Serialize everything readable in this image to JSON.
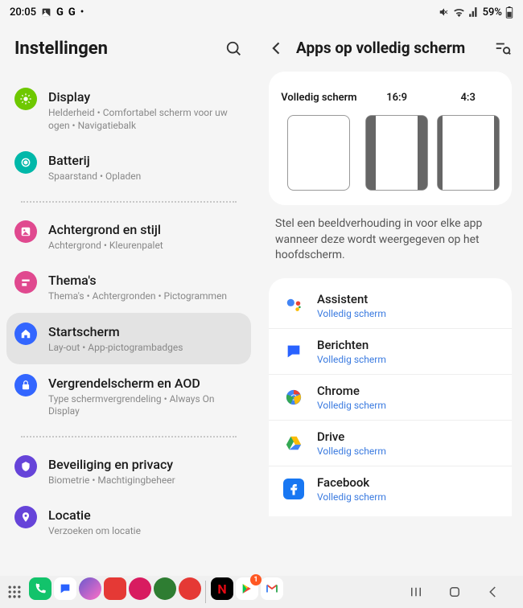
{
  "status": {
    "time": "20:05",
    "battery": "59%"
  },
  "left": {
    "title": "Instellingen",
    "items": [
      {
        "title": "Display",
        "sub": "Helderheid  •  Comfortabel scherm voor uw ogen  •  Navigatiebalk",
        "iconBg": "#6ec800"
      },
      {
        "title": "Batterij",
        "sub": "Spaarstand  •  Opladen",
        "iconBg": "#00b8a9"
      },
      {
        "title": "Achtergrond en stijl",
        "sub": "Achtergrond  •  Kleurenpalet",
        "iconBg": "#e0498f"
      },
      {
        "title": "Thema's",
        "sub": "Thema's  •  Achtergronden  •  Pictogrammen",
        "iconBg": "#e0498f"
      },
      {
        "title": "Startscherm",
        "sub": "Lay-out  •  App-pictogrambadges",
        "iconBg": "#3366ff"
      },
      {
        "title": "Vergrendelscherm en AOD",
        "sub": "Type schermvergrendeling  •  Always On Display",
        "iconBg": "#3366ff"
      },
      {
        "title": "Beveiliging en privacy",
        "sub": "Biometrie  •  Machtigingbeheer",
        "iconBg": "#6644d9"
      },
      {
        "title": "Locatie",
        "sub": "Verzoeken om locatie",
        "iconBg": "#6644d9"
      }
    ]
  },
  "right": {
    "title": "Apps op volledig scherm",
    "aspects": [
      {
        "label": "Volledig scherm",
        "cls": "full"
      },
      {
        "label": "16:9",
        "cls": "r169"
      },
      {
        "label": "4:3",
        "cls": "r43"
      }
    ],
    "description": "Stel een beeldverhouding in voor elke app wanneer deze wordt weergegeven op het hoofdscherm.",
    "apps": [
      {
        "name": "Assistent",
        "setting": "Volledig scherm"
      },
      {
        "name": "Berichten",
        "setting": "Volledig scherm"
      },
      {
        "name": "Chrome",
        "setting": "Volledig scherm"
      },
      {
        "name": "Drive",
        "setting": "Volledig scherm"
      },
      {
        "name": "Facebook",
        "setting": "Volledig scherm"
      }
    ]
  }
}
